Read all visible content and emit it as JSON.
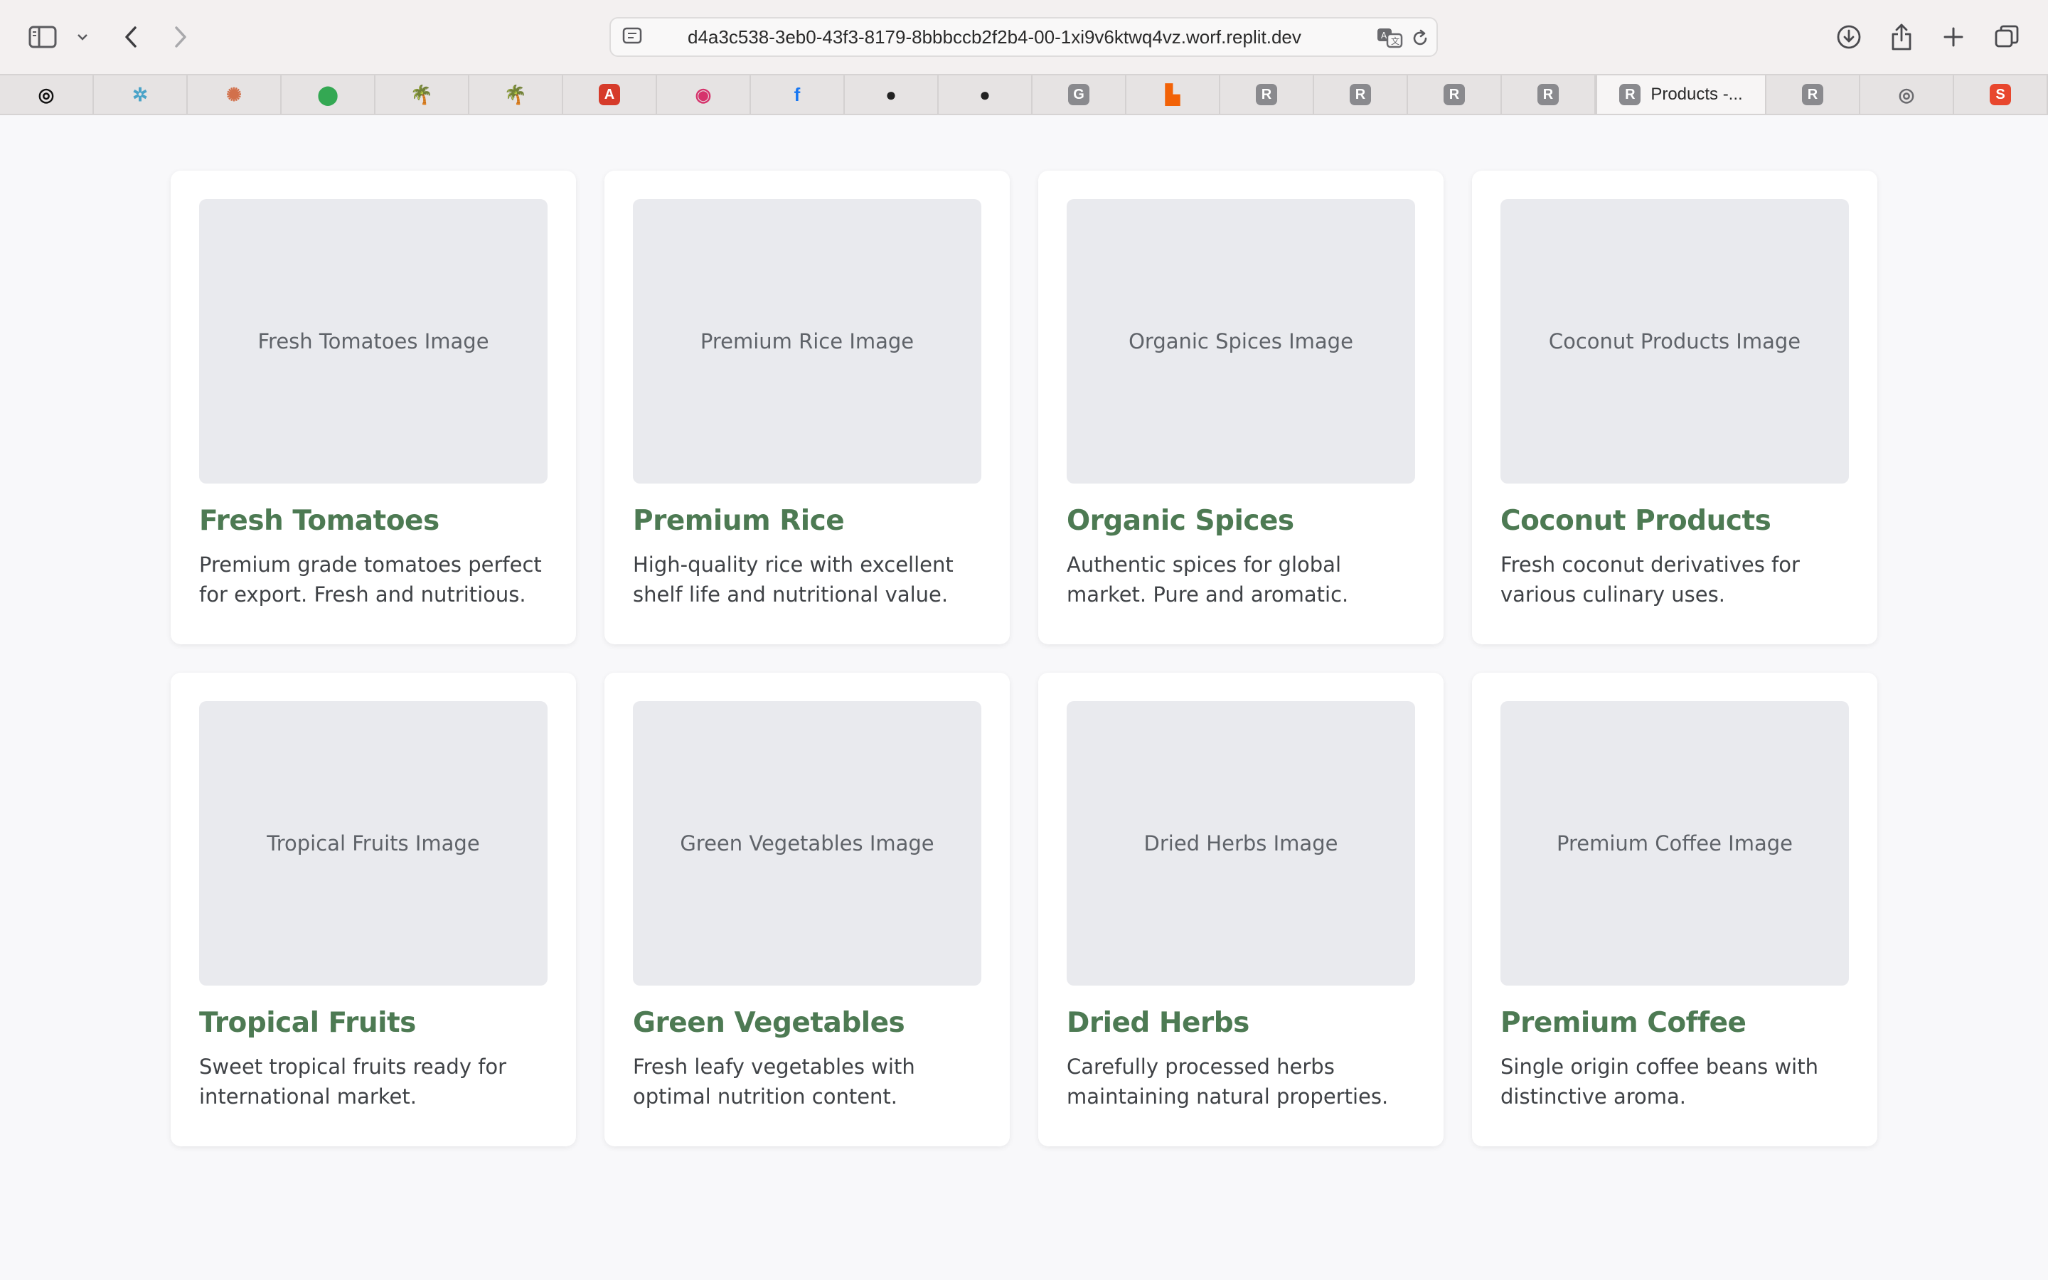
{
  "browser": {
    "address": "d4a3c538-3eb0-43f3-8179-8bbbccb2f2b4-00-1xi9v6ktwq4vz.worf.replit.dev",
    "active_tab_title": "Products -...",
    "favorites": [
      {
        "icon": "openai-icon",
        "glyph": "◎",
        "color": "#111111"
      },
      {
        "icon": "perplexity-icon",
        "glyph": "✲",
        "color": "#4aa3c8"
      },
      {
        "icon": "claude-icon",
        "glyph": "✺",
        "color": "#d2704b"
      },
      {
        "icon": "google-maps-icon",
        "glyph": "⬤",
        "color": "#34a853"
      },
      {
        "icon": "palm-tree-icon",
        "glyph": "🌴",
        "color": "#3a8a3a"
      },
      {
        "icon": "palm-tree-icon",
        "glyph": "🌴",
        "color": "#3a8a3a"
      },
      {
        "icon": "acrobat-icon",
        "glyph": "A",
        "color": "#d63b2a"
      },
      {
        "icon": "instagram-icon",
        "glyph": "◉",
        "color": "#d6336c"
      },
      {
        "icon": "facebook-icon",
        "glyph": "f",
        "color": "#1877f2"
      },
      {
        "icon": "linux-tux-icon",
        "glyph": "●",
        "color": "#222222"
      },
      {
        "icon": "linux-tux-icon",
        "glyph": "●",
        "color": "#222222"
      },
      {
        "icon": "g-letter-icon",
        "glyph": "G",
        "color": "#8a8a8e"
      },
      {
        "icon": "replit-logo-icon",
        "glyph": "▙",
        "color": "#f26207"
      },
      {
        "icon": "r-letter-icon",
        "glyph": "R",
        "color": "#8a8a8e"
      },
      {
        "icon": "r-letter-icon",
        "glyph": "R",
        "color": "#8a8a8e"
      },
      {
        "icon": "r-letter-icon",
        "glyph": "R",
        "color": "#8a8a8e"
      },
      {
        "icon": "r-letter-icon",
        "glyph": "R",
        "color": "#8a8a8e"
      }
    ],
    "trailing_tabs": [
      {
        "icon": "r-letter-icon",
        "glyph": "R",
        "color": "#8a8a8e"
      },
      {
        "icon": "compass-icon",
        "glyph": "◎",
        "color": "#6a6a6e"
      },
      {
        "icon": "shopping-bag-icon",
        "glyph": "S",
        "color": "#e8472e"
      }
    ]
  },
  "products": [
    {
      "image_label": "Fresh Tomatoes Image",
      "title": "Fresh Tomatoes",
      "description": "Premium grade tomatoes perfect for export. Fresh and nutritious."
    },
    {
      "image_label": "Premium Rice Image",
      "title": "Premium Rice",
      "description": "High-quality rice with excellent shelf life and nutritional value."
    },
    {
      "image_label": "Organic Spices Image",
      "title": "Organic Spices",
      "description": "Authentic spices for global market. Pure and aromatic."
    },
    {
      "image_label": "Coconut Products Image",
      "title": "Coconut Products",
      "description": "Fresh coconut derivatives for various culinary uses."
    },
    {
      "image_label": "Tropical Fruits Image",
      "title": "Tropical Fruits",
      "description": "Sweet tropical fruits ready for international market."
    },
    {
      "image_label": "Green Vegetables Image",
      "title": "Green Vegetables",
      "description": "Fresh leafy vegetables with optimal nutrition content."
    },
    {
      "image_label": "Dried Herbs Image",
      "title": "Dried Herbs",
      "description": "Carefully processed herbs maintaining natural properties."
    },
    {
      "image_label": "Premium Coffee Image",
      "title": "Premium Coffee",
      "description": "Single origin coffee beans with distinctive aroma."
    }
  ],
  "colors": {
    "title_green": "#4d7a53",
    "placeholder_bg": "#e9eaee",
    "page_bg": "#f8f8fa"
  }
}
